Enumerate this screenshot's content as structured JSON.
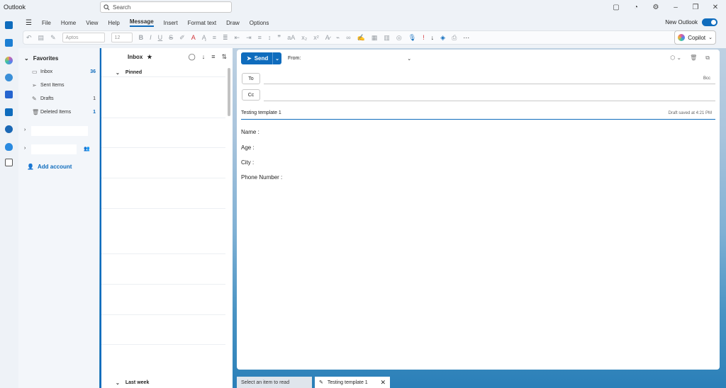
{
  "app": {
    "title": "Outlook"
  },
  "search": {
    "placeholder": "Search"
  },
  "menu": {
    "items": [
      "File",
      "Home",
      "View",
      "Help",
      "Message",
      "Insert",
      "Format text",
      "Draw",
      "Options"
    ],
    "active": "Message"
  },
  "new_outlook": {
    "label": "New Outlook",
    "enabled": true
  },
  "toolbar": {
    "font": "Aptos",
    "size": "12",
    "copilot": "Copilot"
  },
  "folders": {
    "favorites": "Favorites",
    "items": [
      {
        "label": "Inbox",
        "count": "36"
      },
      {
        "label": "Sent Items",
        "count": ""
      },
      {
        "label": "Drafts",
        "count": "1"
      },
      {
        "label": "Deleted Items",
        "count": "1"
      }
    ],
    "add_account": "Add account"
  },
  "message_list": {
    "title": "Inbox",
    "pinned": "Pinned",
    "last_week": "Last week"
  },
  "compose": {
    "send": "Send",
    "from": "From:",
    "to": "To",
    "cc": "Cc",
    "bcc": "Bcc",
    "subject": "Testing template 1",
    "draft_saved": "Draft saved at 4:21 PM",
    "body": [
      "Name :",
      "Age :",
      "City :",
      "Phone Number :"
    ]
  },
  "tabs": {
    "reading": "Select an item to read",
    "draft": "Testing template 1"
  },
  "colors": {
    "accent": "#0f6cbd"
  }
}
